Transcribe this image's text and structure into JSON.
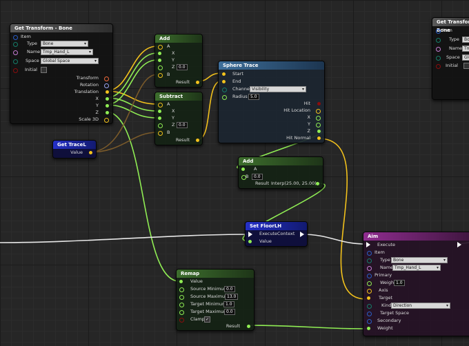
{
  "colors": {
    "vector": "#f3c21c",
    "float": "#90ee54",
    "struct": "#2a5ec8",
    "name": "#c77dd6",
    "enum": "#157f6a",
    "bool": "#8a0d0d",
    "transform": "#f26a3c",
    "rotator": "#9aa3f1",
    "exec": "#ffffff"
  },
  "get_transform_left": {
    "title": "Get Transform - Bone",
    "item": "Item",
    "type_label": "Type",
    "type_value": "Bone",
    "name_label": "Name",
    "name_value": "Tmp_Hand_L",
    "space_label": "Space",
    "space_value": "Global Space",
    "initial_label": "Initial",
    "outputs": [
      "Transform",
      "Rotation",
      "Translation",
      "X",
      "Y",
      "Z",
      "Scale 3D"
    ]
  },
  "get_transform_right": {
    "title": "Get Transform - Bone",
    "item": "Item",
    "type_label": "Type",
    "type_value": "Bone",
    "name_label": "Name",
    "name_value": "Tm",
    "space_label": "Space",
    "space_value": "Global",
    "initial_label": "Initial"
  },
  "add_top": {
    "title": "Add",
    "a": "A",
    "x": "X",
    "y": "Y",
    "z": "Z",
    "z_value": "0.0",
    "b": "B",
    "result": "Result"
  },
  "subtract": {
    "title": "Subtract",
    "a": "A",
    "x": "X",
    "y": "Y",
    "z": "Z",
    "z_value": "0.0",
    "b": "B",
    "result": "Result"
  },
  "sphere_trace": {
    "title": "Sphere Trace",
    "start": "Start",
    "end": "End",
    "channel_label": "Channel",
    "channel_value": "Visibility",
    "radius_label": "Radius",
    "radius_value": "5.0",
    "outputs": [
      "Hit",
      "Hit Location",
      "X",
      "Y",
      "Z",
      "Hit Normal"
    ]
  },
  "get_trace": {
    "title": "Get TraceL",
    "value": "Value"
  },
  "add_mid": {
    "title": "Add",
    "a": "A",
    "b": "B",
    "b_value": "0.0",
    "result_label": "Result",
    "result_value": "Interp(25.00, 25.00)"
  },
  "set_floor": {
    "title": "Set FloorLH",
    "context": "ExecuteContext",
    "value": "Value"
  },
  "remap": {
    "title": "Remap",
    "value": "Value",
    "src_min_label": "Source Minimum",
    "src_min_value": "0.0",
    "src_max_label": "Source Maximum",
    "src_max_value": "13.0",
    "tgt_min_label": "Target Minimum",
    "tgt_min_value": "1.0",
    "tgt_max_label": "Target Maximum",
    "tgt_max_value": "0.0",
    "clamp_label": "Clamp",
    "clamp_mark": "✓",
    "result": "Result"
  },
  "aim": {
    "title": "Aim",
    "execute": "Execute",
    "item": "Item",
    "type_label": "Type",
    "type_value": "Bone",
    "name_label": "Name",
    "name_value": "Tmp_Hand_L",
    "primary": "Primary",
    "weight_label": "Weight",
    "weight_value": "1.0",
    "axis": "Axis",
    "target": "Target",
    "kind_label": "Kind",
    "kind_value": "Direction",
    "target_space": "Target Space",
    "secondary": "Secondary",
    "weight2": "Weight"
  }
}
